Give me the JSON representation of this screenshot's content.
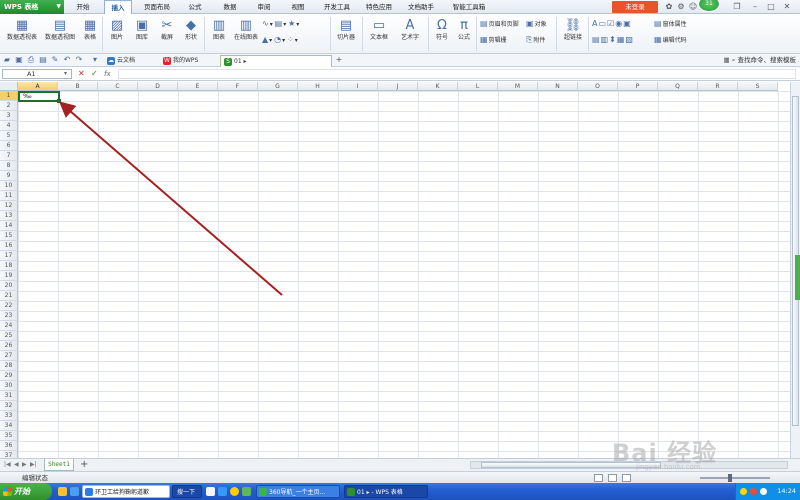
{
  "app": {
    "name": "WPS 表格",
    "login_label": "未登录",
    "badge": "31"
  },
  "menu": [
    "开始",
    "插入",
    "页面布局",
    "公式",
    "数据",
    "审阅",
    "视图",
    "开发工具",
    "特色应用",
    "文档助手",
    "智能工具箱"
  ],
  "menu_active_index": 1,
  "ribbon": {
    "pivot_table": "数据透视表",
    "pivot_chart": "数据透视图",
    "table": "表格",
    "picture": "图片",
    "gallery": "图库",
    "screenshot": "截屏",
    "shapes": "形状",
    "chart": "图表",
    "online_chart": "在线图表",
    "slicer": "切片器",
    "textbox": "文本框",
    "wordart": "艺术字",
    "symbol": "符号",
    "formula": "公式",
    "header_footer": "页眉和页脚",
    "object": "对象",
    "clip": "剪辑栅",
    "attachment": "附件",
    "hyperlink": "超链接",
    "form_props": "窗体属性",
    "edit_code": "编辑代码"
  },
  "toolbar": {
    "cloud_doc": "云文档",
    "my_wps": "我的WPS",
    "doc_tab": "01 ▸",
    "search": "查找命令、搜索模板"
  },
  "formula_bar": {
    "cell_ref": "A1",
    "fx": "fx",
    "value": ""
  },
  "grid": {
    "columns": [
      "A",
      "B",
      "C",
      "D",
      "E",
      "F",
      "G",
      "H",
      "I",
      "J",
      "K",
      "L",
      "M",
      "N",
      "O",
      "P",
      "Q",
      "R",
      "S"
    ],
    "rows": [
      "1",
      "2",
      "3",
      "4",
      "5",
      "6",
      "7",
      "8",
      "9",
      "10",
      "11",
      "12",
      "13",
      "14",
      "15",
      "16",
      "17",
      "18",
      "19",
      "20",
      "21",
      "22",
      "23",
      "24",
      "25",
      "26",
      "27",
      "28",
      "29",
      "30",
      "31",
      "32",
      "33",
      "34",
      "35",
      "36",
      "37"
    ],
    "active_cell_value": "‰"
  },
  "sheet": {
    "tab": "Sheet1",
    "add": "+"
  },
  "status": {
    "mode": "编辑状态"
  },
  "taskbar": {
    "start": "开始",
    "task1": "环卫工给狗鞠躬道歉",
    "search_btn": "搜一下",
    "task2": "360导航_一个主页...",
    "task3": "01 ▸ - WPS 表格",
    "time": "14:24"
  },
  "watermark": {
    "main": "Bai 经验",
    "sub": "jingyan.baidu.com"
  },
  "colors": {
    "accent_green": "#1f8a30",
    "arrow": "#a52121",
    "login": "#e8542a",
    "taskbar": "#245ed1"
  }
}
